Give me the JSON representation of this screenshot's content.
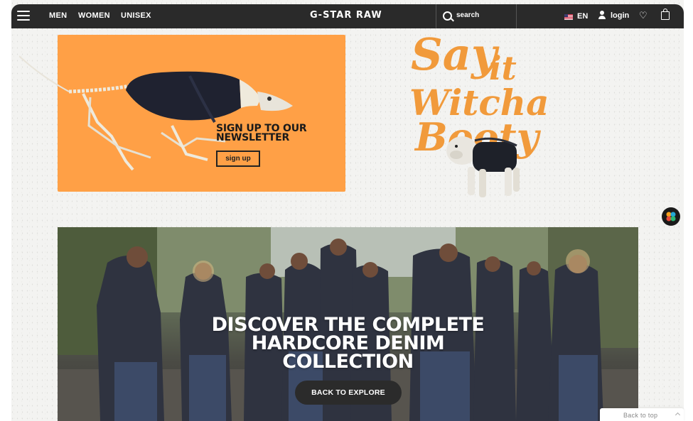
{
  "nav": {
    "links": [
      {
        "label": "MEN"
      },
      {
        "label": "WOMEN"
      },
      {
        "label": "UNISEX"
      }
    ],
    "brand": "G-STAR RAW",
    "search_label": "search",
    "language": "EN",
    "login_label": "login",
    "icons": [
      "menu-icon",
      "search-icon",
      "flag-us-icon",
      "user-icon",
      "heart-icon",
      "bag-icon"
    ]
  },
  "newsletter": {
    "title_line1": "SIGN UP TO OUR",
    "title_line2": "NEWSLETTER",
    "button_label": "sign up",
    "background_color": "#ffa046"
  },
  "promo_art": {
    "text_lines": [
      "Say",
      "it",
      "Witcha",
      "Booty"
    ],
    "color": "#f19a3b"
  },
  "banner": {
    "headline_line1": "DISCOVER THE COMPLETE",
    "headline_line2": "HARDCORE DENIM",
    "headline_line3": "COLLECTION",
    "button_label": "BACK TO EXPLORE"
  },
  "footer": {
    "back_to_top": "Back to top"
  },
  "colors": {
    "nav_bg": "#2a2a2a",
    "accent_orange": "#ffa046",
    "button_dark": "#2b2b2b"
  }
}
